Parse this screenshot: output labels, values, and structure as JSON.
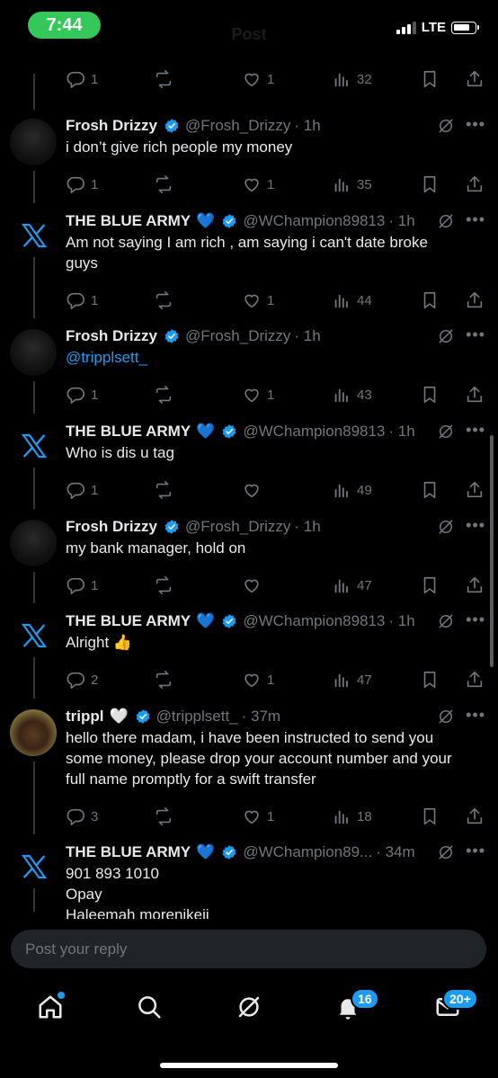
{
  "status_bar": {
    "time": "7:44",
    "network": "LTE"
  },
  "header": {
    "title": "Post"
  },
  "top_actions": {
    "replies": "1",
    "reposts": "",
    "likes": "1",
    "views": "32"
  },
  "posts": [
    {
      "name": "Frosh Drizzy",
      "emoji": "",
      "handle": "@Frosh_Drizzy",
      "time": "· 1h",
      "avatar": "dark",
      "lines": [
        "i don’t give rich people my money"
      ],
      "replies": "1",
      "reposts": "",
      "likes": "1",
      "views": "35"
    },
    {
      "name": "THE BLUE ARMY",
      "emoji": "💙",
      "handle": "@WChampion89813",
      "time": "· 1h",
      "avatar": "x",
      "lines": [
        "Am not saying I am rich , am saying i can't date broke",
        "guys"
      ],
      "replies": "1",
      "reposts": "",
      "likes": "1",
      "views": "44"
    },
    {
      "name": "Frosh Drizzy",
      "emoji": "",
      "handle": "@Frosh_Drizzy",
      "time": "· 1h",
      "avatar": "dark",
      "lines": [
        "@tripplsett_"
      ],
      "link_line": true,
      "replies": "1",
      "reposts": "",
      "likes": "1",
      "views": "43"
    },
    {
      "name": "THE BLUE ARMY",
      "emoji": "💙",
      "handle": "@WChampion89813",
      "time": "· 1h",
      "avatar": "x",
      "lines": [
        "Who is dis u tag"
      ],
      "replies": "1",
      "reposts": "",
      "likes": "",
      "views": "49"
    },
    {
      "name": "Frosh Drizzy",
      "emoji": "",
      "handle": "@Frosh_Drizzy",
      "time": "· 1h",
      "avatar": "dark",
      "lines": [
        "my bank manager, hold on"
      ],
      "replies": "1",
      "reposts": "",
      "likes": "",
      "views": "47"
    },
    {
      "name": "THE BLUE ARMY",
      "emoji": "💙",
      "handle": "@WChampion89813",
      "time": "· 1h",
      "avatar": "x",
      "lines": [
        "Alright 👍"
      ],
      "replies": "2",
      "reposts": "",
      "likes": "1",
      "views": "47"
    },
    {
      "name": "trippl",
      "emoji": "🤍",
      "handle": "@tripplsett_",
      "time": "· 37m",
      "avatar": "trippl",
      "lines": [
        "hello there madam, i have been instructed to send you",
        "some money, please drop your account number and your",
        "full name promptly for a swift transfer"
      ],
      "replies": "3",
      "reposts": "",
      "likes": "1",
      "views": "18"
    },
    {
      "name": "THE BLUE ARMY",
      "emoji": "💙",
      "handle": "@WChampion89...",
      "time": "· 34m",
      "avatar": "x",
      "lines": [
        "901 893 1010",
        "Opay",
        "Haleemah morenikeji"
      ],
      "replies": "",
      "reposts": "",
      "likes": "",
      "views": ""
    }
  ],
  "reply_bar": {
    "placeholder": "Post your reply"
  },
  "tabbar": {
    "notifications_badge": "16",
    "messages_badge": "20+"
  },
  "colors": {
    "accent": "#1d9bf0",
    "muted": "#71767b",
    "text": "#e7e9ea",
    "background": "#000000",
    "time_pill": "#34c759"
  }
}
